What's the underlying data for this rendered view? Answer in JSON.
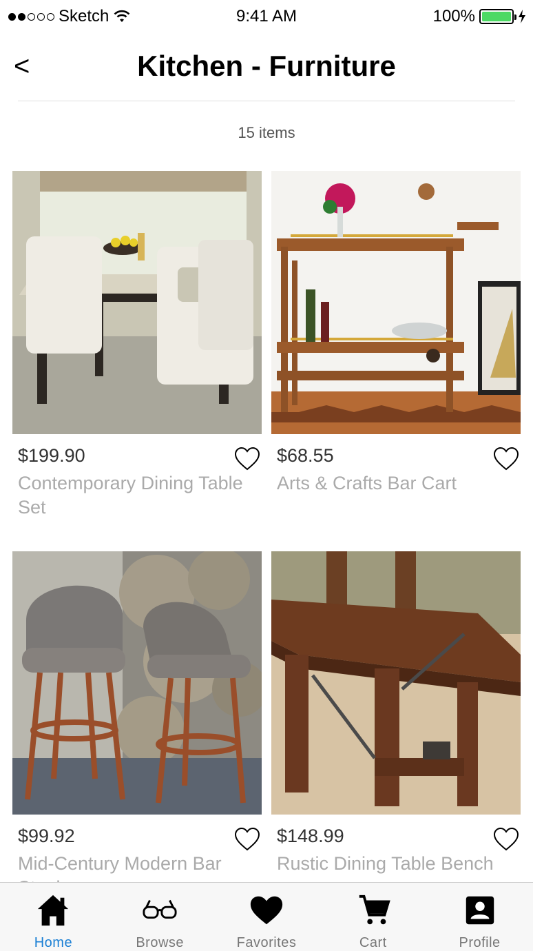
{
  "status_bar": {
    "carrier": "Sketch",
    "time": "9:41 AM",
    "battery": "100%"
  },
  "header": {
    "back": "<",
    "title": "Kitchen - Furniture"
  },
  "item_count": "15 items",
  "products": [
    {
      "price": "$199.90",
      "name": "Contemporary Dining Table Set",
      "image": "dining-table-set"
    },
    {
      "price": "$68.55",
      "name": "Arts & Crafts Bar Cart",
      "image": "bar-cart"
    },
    {
      "price": "$99.92",
      "name": "Mid-Century Modern Bar Stools",
      "image": "bar-stools"
    },
    {
      "price": "$148.99",
      "name": "Rustic Dining Table Bench",
      "image": "dining-bench"
    }
  ],
  "tabs": [
    {
      "label": "Home",
      "icon": "home-icon",
      "active": true
    },
    {
      "label": "Browse",
      "icon": "glasses-icon",
      "active": false
    },
    {
      "label": "Favorites",
      "icon": "heart-icon",
      "active": false
    },
    {
      "label": "Cart",
      "icon": "cart-icon",
      "active": false
    },
    {
      "label": "Profile",
      "icon": "profile-icon",
      "active": false
    }
  ],
  "colors": {
    "accent": "#1a7fd4",
    "battery": "#4cd964"
  }
}
